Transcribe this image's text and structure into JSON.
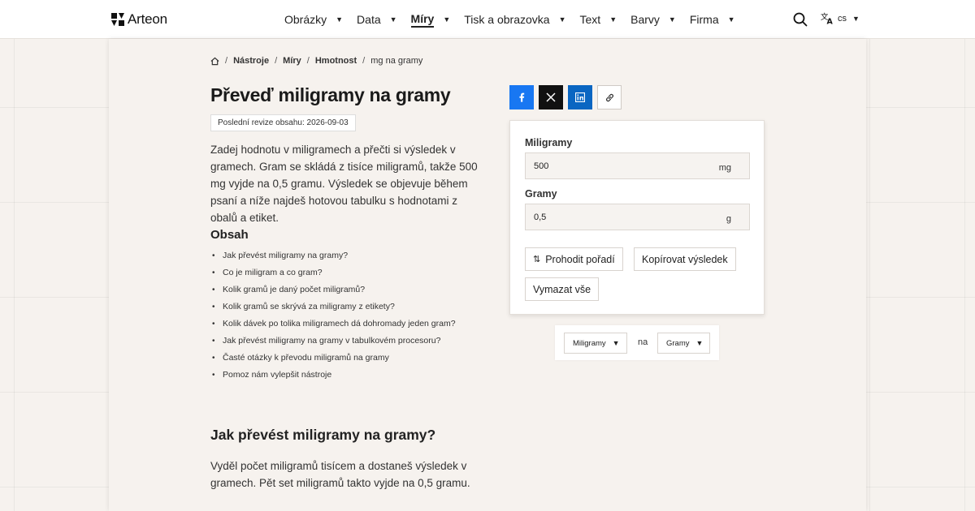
{
  "header": {
    "brand": "Arteon",
    "nav": [
      {
        "label": "Obrázky",
        "active": false
      },
      {
        "label": "Data",
        "active": false
      },
      {
        "label": "Míry",
        "active": true
      },
      {
        "label": "Tisk a obrazovka",
        "active": false
      },
      {
        "label": "Text",
        "active": false
      },
      {
        "label": "Barvy",
        "active": false
      },
      {
        "label": "Firma",
        "active": false
      }
    ],
    "language": "cs",
    "icons": {
      "search": "search-icon",
      "language": "translate-icon",
      "home": "home-icon"
    }
  },
  "breadcrumb": {
    "items": [
      "Nástroje",
      "Míry",
      "Hmotnost"
    ],
    "current": "mg na gramy"
  },
  "page": {
    "title": "Převeď miligramy na gramy",
    "revision": "Poslední revize obsahu: 2026-09-03",
    "intro": "Zadej hodnotu v miligramech a přečti si výsledek v gramech. Gram se skládá z tisíce miligramů, takže 500 mg vyjde na 0,5 gramu. Výsledek se objevuje během psaní a níže najdeš hotovou tabulku s hodnotami z obalů a etiket.",
    "toc_title": "Obsah",
    "toc": [
      "Jak převést miligramy na gramy?",
      "Co je miligram a co gram?",
      "Kolik gramů je daný počet miligramů?",
      "Kolik gramů se skrývá za miligramy z etikety?",
      "Kolik dávek po tolika miligramech dá dohromady jeden gram?",
      "Jak převést miligramy na gramy v tabulkovém procesoru?",
      "Časté otázky k převodu miligramů na gramy",
      "Pomoz nám vylepšit nástroje"
    ],
    "section_title": "Jak převést miligramy na gramy?",
    "section_text": "Vyděl počet miligramů tisícem a dostaneš výsledek v gramech. Pět set miligramů takto vyjde na 0,5 gramu."
  },
  "share": {
    "buttons": [
      "facebook-icon",
      "x-icon",
      "linkedin-icon",
      "link-icon"
    ],
    "colors": {
      "facebook": "#1877f2",
      "x": "#111111",
      "linkedin": "#0a66c2"
    }
  },
  "converter": {
    "from_label": "Miligramy",
    "from_value": "500",
    "from_unit": "mg",
    "to_label": "Gramy",
    "to_value": "0,5",
    "to_unit": "g",
    "swap_label": "Prohodit pořadí",
    "copy_label": "Kopírovat výsledek",
    "clear_label": "Vymazat vše"
  },
  "unit_selector": {
    "from": "Miligramy",
    "connector": "na",
    "to": "Gramy"
  }
}
